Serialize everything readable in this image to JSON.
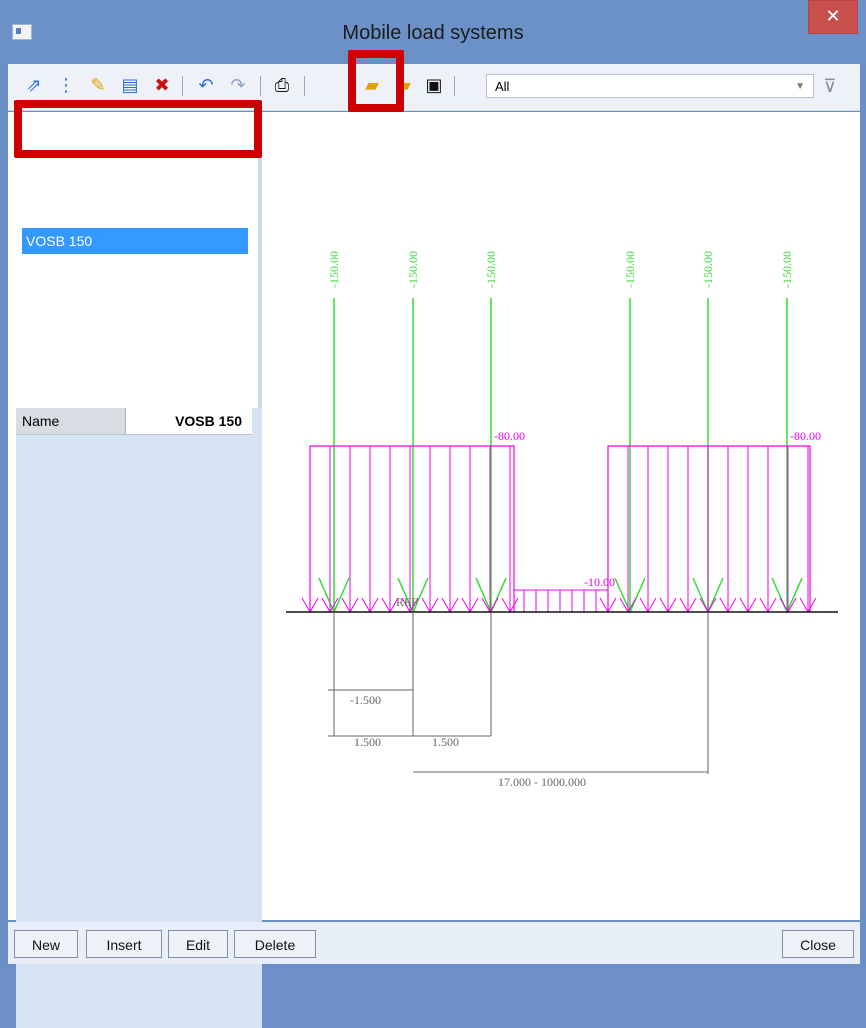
{
  "window": {
    "title": "Mobile load systems",
    "close_label": "✕"
  },
  "toolbar": {
    "filter_value": "All",
    "icons": [
      "new-icon",
      "select-icon",
      "edit-icon",
      "copy-icon",
      "delete-icon",
      "undo-icon",
      "redo-icon",
      "print-icon",
      "open-folder-icon",
      "folder-icon",
      "save-icon",
      "filter-icon"
    ]
  },
  "left": {
    "list_items": [
      "VOSB 150"
    ],
    "properties": [
      {
        "name": "Name",
        "value": "VOSB 150"
      }
    ]
  },
  "drawing": {
    "point_loads": [
      "-150.00",
      "-150.00",
      "-150.00",
      "-150.00",
      "-150.00",
      "-150.00"
    ],
    "distributed_loads": [
      "-80.00",
      "-80.00"
    ],
    "center_load": "-10.00",
    "ref_label": "REF",
    "dims": {
      "d1": "-1.500",
      "d2": "1.500",
      "d3": "1.500",
      "d4": "17.000 - 1000.000"
    },
    "colors": {
      "green": "#33dd33",
      "magenta": "#ee00ee",
      "gray": "#666666",
      "black": "#111111"
    }
  },
  "bottom": {
    "new": "New",
    "insert": "Insert",
    "edit": "Edit",
    "delete": "Delete",
    "close": "Close"
  }
}
